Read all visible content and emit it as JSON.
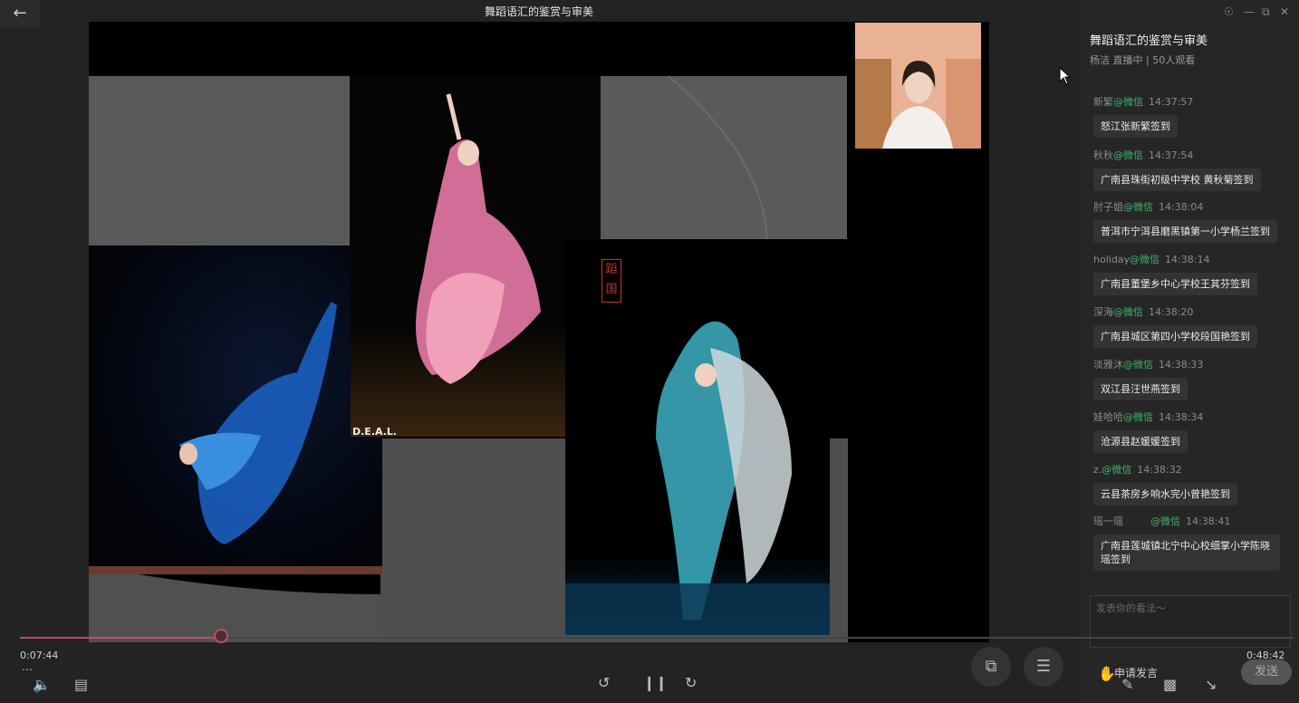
{
  "window": {
    "title": "舞蹈语汇的鉴赏与审美"
  },
  "panel": {
    "title": "舞蹈语汇的鉴赏与审美",
    "subtitle": "杨洁 直播中 | 50人观看"
  },
  "chat": [
    {
      "user": "新繁",
      "platform": "@微信",
      "time": "14:37:57",
      "text": "怒江张新繁签到"
    },
    {
      "user": "秋秋",
      "platform": "@微信",
      "time": "14:37:54",
      "text": "广南县珠街初级中学校  黄秋菊签到"
    },
    {
      "user": "肘子姐",
      "platform": "@微信",
      "time": "14:38:04",
      "text": "普洱市宁洱县磨黑镇第一小学杨兰签到"
    },
    {
      "user": "holiday",
      "platform": "@微信",
      "time": "14:38:14",
      "text": "广南县董堡乡中心学校王其芬签到"
    },
    {
      "user": "深海",
      "platform": "@微信",
      "time": "14:38:20",
      "text": "广南县城区第四小学校段国艳签到"
    },
    {
      "user": "淡雅沐",
      "platform": "@微信",
      "time": "14:38:33",
      "text": "双江县汪世燕签到"
    },
    {
      "user": "娃哈哈",
      "platform": "@微信",
      "time": "14:38:34",
      "text": "沧源县赵媛媛签到"
    },
    {
      "user": "z.",
      "platform": "@微信",
      "time": "14:38:32",
      "text": "云县茶房乡响水完小曾艳签到"
    },
    {
      "user": "瑶一瑶",
      "platform": "@微信",
      "time": "14:38:41",
      "text": "广南县莲城镇北宁中心校细掌小学陈晓瑶签到"
    }
  ],
  "input": {
    "placeholder": "发表你的看法～"
  },
  "buttons": {
    "apply": "申请发言",
    "send": "发送"
  },
  "player": {
    "current": "0:07:44",
    "duration": "0:48:42",
    "progress": 0.158
  },
  "slide": {
    "watermark": "D.E.A.L.",
    "seal": "蹈国"
  },
  "icons": [
    "back-arrow-icon",
    "pin-icon",
    "minimize-icon",
    "restore-icon",
    "close-icon",
    "volume-icon",
    "subtitle-icon",
    "rewind-10-icon",
    "pause-icon",
    "forward-30-icon",
    "screen-switch-icon",
    "view-mode-icon",
    "pencil-icon",
    "screen-icon",
    "shrink-icon",
    "more-icon",
    "hand-icon"
  ]
}
